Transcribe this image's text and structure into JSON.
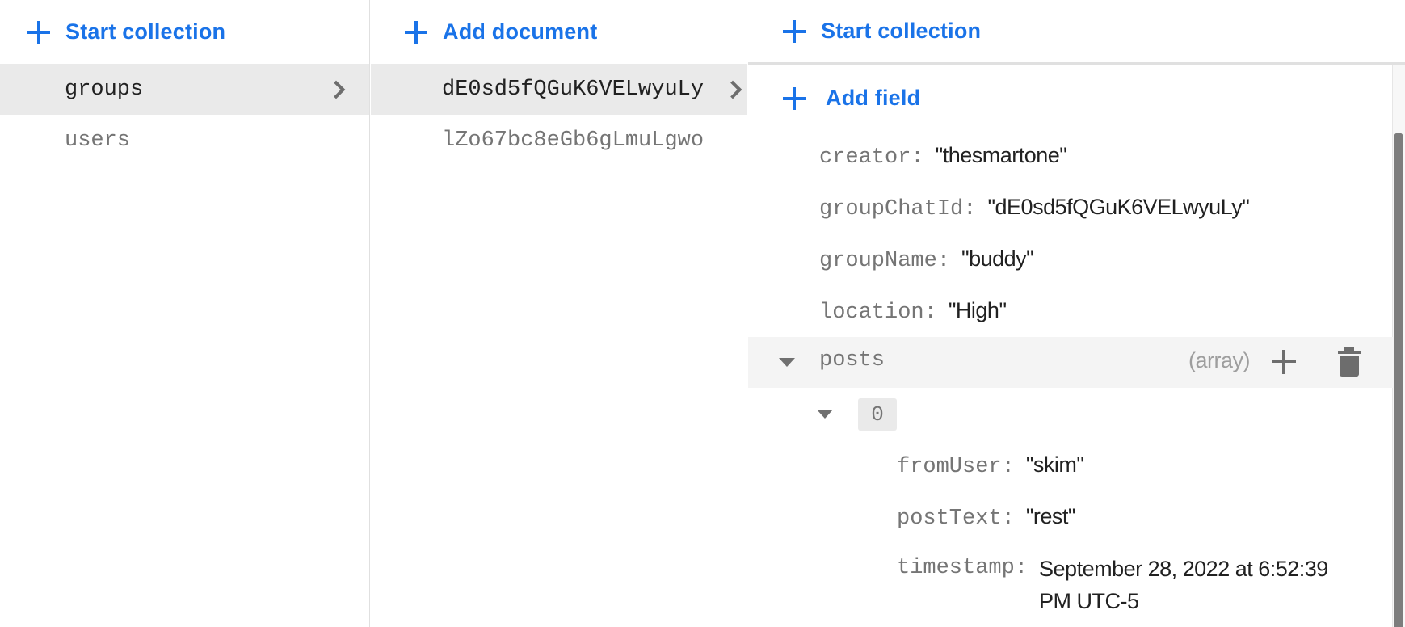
{
  "collections_panel": {
    "action_label": "Start collection",
    "action_icon": "plus-icon",
    "items": [
      {
        "label": "groups",
        "selected": true
      },
      {
        "label": "users",
        "selected": false
      }
    ]
  },
  "documents_panel": {
    "action_label": "Add document",
    "action_icon": "plus-icon",
    "items": [
      {
        "label": "dE0sd5fQGuK6VELwyuLy",
        "selected": true
      },
      {
        "label": "lZo67bc8eGb6gLmuLgwo",
        "selected": false
      }
    ]
  },
  "fields_panel": {
    "start_collection_label": "Start collection",
    "add_field_label": "Add field",
    "fields": [
      {
        "key": "creator",
        "value": "\"thesmartone\""
      },
      {
        "key": "groupChatId",
        "value": "\"dE0sd5fQGuK6VELwyuLy\""
      },
      {
        "key": "groupName",
        "value": "\"buddy\""
      },
      {
        "key": "location",
        "value": "\"High\""
      }
    ],
    "array_field": {
      "key": "posts",
      "type_label": "(array)",
      "expanded": true,
      "items": [
        {
          "index": "0",
          "expanded": true,
          "fields": [
            {
              "key": "fromUser",
              "value": "\"skim\""
            },
            {
              "key": "postText",
              "value": "\"rest\""
            },
            {
              "key": "timestamp",
              "value": "September 28, 2022 at 6:52:39",
              "value_line2": "PM UTC-5"
            }
          ]
        }
      ]
    },
    "colon": ":"
  },
  "colors": {
    "accent": "#1a73e8",
    "selected_row": "#eaeaea",
    "array_row": "#f4f4f4",
    "key_text": "#757575",
    "value_text": "#212121"
  }
}
